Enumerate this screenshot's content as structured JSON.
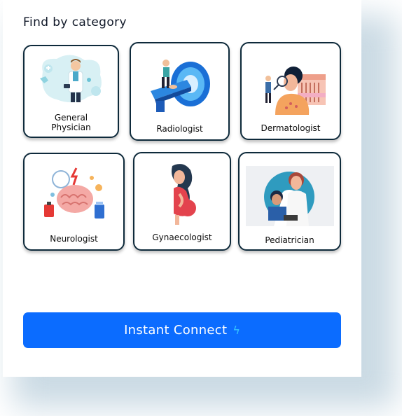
{
  "section_title": "Find by category",
  "categories": [
    {
      "label": "General\nPhysician",
      "icon": "general-physician-illustration"
    },
    {
      "label": "Radiologist",
      "icon": "mri-scanner-illustration"
    },
    {
      "label": "Dermatologist",
      "icon": "skin-exam-illustration"
    },
    {
      "label": "Neurologist",
      "icon": "brain-illustration"
    },
    {
      "label": "Gynaecologist",
      "icon": "pregnant-woman-illustration"
    },
    {
      "label": "Pediatrician",
      "icon": "doctor-with-child-illustration"
    }
  ],
  "cta": {
    "label": "Instant Connect",
    "icon": "lightning-bolt-icon"
  },
  "colors": {
    "accent": "#0b6cff",
    "tile_border": "#0e2a3b",
    "bolt": "#36c5ff"
  }
}
